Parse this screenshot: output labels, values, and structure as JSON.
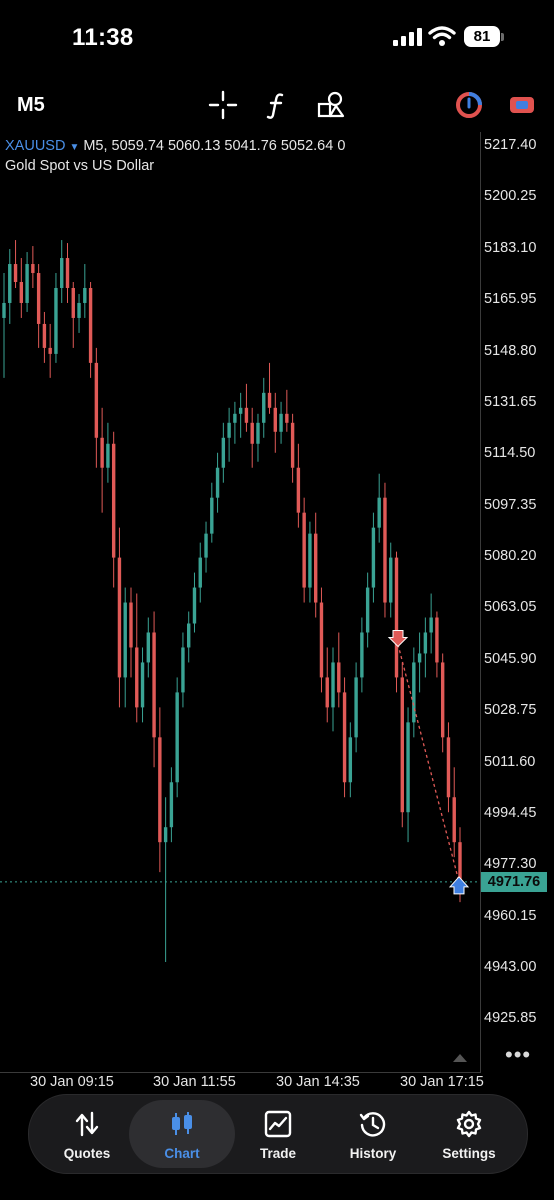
{
  "status_bar": {
    "time": "11:38",
    "battery": "81"
  },
  "toolbar": {
    "timeframe": "M5",
    "icons": [
      "crosshair-icon",
      "indicators-icon",
      "objects-icon",
      "one-click-trading-icon",
      "chart-color-icon"
    ]
  },
  "chart": {
    "symbol": "XAUUSD",
    "ohlc_line": "M5, 5059.74 5060.13 5041.76 5052.64 0",
    "description": "Gold Spot vs US Dollar",
    "current_price": "4971.76",
    "bullish_color": "#3aa394",
    "bearish_color": "#e05a57"
  },
  "chart_data": {
    "type": "candlestick",
    "price_axis": [
      "5217.40",
      "5200.25",
      "5183.10",
      "5165.95",
      "5148.80",
      "5131.65",
      "5114.50",
      "5097.35",
      "5080.20",
      "5063.05",
      "5045.90",
      "5028.75",
      "5011.60",
      "4994.45",
      "4977.30",
      "4960.15",
      "4943.00",
      "4925.85"
    ],
    "time_axis": [
      "30 Jan 09:15",
      "30 Jan 11:55",
      "30 Jan 14:35",
      "30 Jan 17:15"
    ],
    "ylim": [
      4918,
      5222
    ],
    "current_price": 4971.76,
    "trades": [
      {
        "type": "sell",
        "price": 5051
      },
      {
        "type": "buy",
        "price": 4971.76
      }
    ],
    "candles": [
      [
        5160,
        5175,
        5140,
        5165
      ],
      [
        5165,
        5183,
        5158,
        5178
      ],
      [
        5178,
        5186,
        5170,
        5172
      ],
      [
        5172,
        5180,
        5160,
        5165
      ],
      [
        5165,
        5182,
        5162,
        5178
      ],
      [
        5178,
        5184,
        5170,
        5175
      ],
      [
        5175,
        5178,
        5150,
        5158
      ],
      [
        5158,
        5162,
        5145,
        5150
      ],
      [
        5150,
        5158,
        5140,
        5148
      ],
      [
        5148,
        5175,
        5145,
        5170
      ],
      [
        5170,
        5186,
        5165,
        5180
      ],
      [
        5180,
        5185,
        5165,
        5170
      ],
      [
        5170,
        5172,
        5150,
        5160
      ],
      [
        5160,
        5168,
        5155,
        5165
      ],
      [
        5165,
        5178,
        5160,
        5170
      ],
      [
        5170,
        5172,
        5140,
        5145
      ],
      [
        5145,
        5150,
        5110,
        5120
      ],
      [
        5120,
        5130,
        5095,
        5110
      ],
      [
        5110,
        5125,
        5105,
        5118
      ],
      [
        5118,
        5122,
        5070,
        5080
      ],
      [
        5080,
        5090,
        5030,
        5040
      ],
      [
        5040,
        5070,
        5030,
        5065
      ],
      [
        5065,
        5070,
        5040,
        5050
      ],
      [
        5050,
        5068,
        5025,
        5030
      ],
      [
        5030,
        5050,
        5025,
        5045
      ],
      [
        5045,
        5060,
        5040,
        5055
      ],
      [
        5055,
        5062,
        5010,
        5020
      ],
      [
        5020,
        5030,
        4975,
        4985
      ],
      [
        4985,
        5000,
        4945,
        4990
      ],
      [
        4990,
        5010,
        4985,
        5005
      ],
      [
        5005,
        5040,
        5000,
        5035
      ],
      [
        5035,
        5055,
        5030,
        5050
      ],
      [
        5050,
        5062,
        5045,
        5058
      ],
      [
        5058,
        5075,
        5055,
        5070
      ],
      [
        5070,
        5085,
        5065,
        5080
      ],
      [
        5080,
        5092,
        5075,
        5088
      ],
      [
        5088,
        5105,
        5085,
        5100
      ],
      [
        5100,
        5115,
        5095,
        5110
      ],
      [
        5110,
        5125,
        5105,
        5120
      ],
      [
        5120,
        5130,
        5112,
        5125
      ],
      [
        5125,
        5132,
        5118,
        5128
      ],
      [
        5128,
        5135,
        5120,
        5130
      ],
      [
        5130,
        5138,
        5122,
        5125
      ],
      [
        5125,
        5130,
        5110,
        5118
      ],
      [
        5118,
        5128,
        5112,
        5125
      ],
      [
        5125,
        5140,
        5120,
        5135
      ],
      [
        5135,
        5145,
        5128,
        5130
      ],
      [
        5130,
        5135,
        5115,
        5122
      ],
      [
        5122,
        5132,
        5118,
        5128
      ],
      [
        5128,
        5136,
        5122,
        5125
      ],
      [
        5125,
        5128,
        5105,
        5110
      ],
      [
        5110,
        5118,
        5090,
        5095
      ],
      [
        5095,
        5100,
        5065,
        5070
      ],
      [
        5070,
        5092,
        5065,
        5088
      ],
      [
        5088,
        5095,
        5060,
        5065
      ],
      [
        5065,
        5070,
        5035,
        5040
      ],
      [
        5040,
        5050,
        5025,
        5030
      ],
      [
        5030,
        5050,
        5022,
        5045
      ],
      [
        5045,
        5055,
        5030,
        5035
      ],
      [
        5035,
        5040,
        5000,
        5005
      ],
      [
        5005,
        5025,
        5000,
        5020
      ],
      [
        5020,
        5045,
        5015,
        5040
      ],
      [
        5040,
        5060,
        5035,
        5055
      ],
      [
        5055,
        5075,
        5050,
        5070
      ],
      [
        5070,
        5095,
        5065,
        5090
      ],
      [
        5090,
        5108,
        5085,
        5100
      ],
      [
        5100,
        5105,
        5060,
        5065
      ],
      [
        5065,
        5085,
        5060,
        5080
      ],
      [
        5080,
        5082,
        5035,
        5040
      ],
      [
        5040,
        5045,
        4990,
        4995
      ],
      [
        4995,
        5030,
        4985,
        5025
      ],
      [
        5025,
        5050,
        5020,
        5045
      ],
      [
        5045,
        5055,
        5035,
        5048
      ],
      [
        5048,
        5060,
        5040,
        5055
      ],
      [
        5055,
        5068,
        5048,
        5060
      ],
      [
        5060,
        5062,
        5040,
        5045
      ],
      [
        5045,
        5048,
        5015,
        5020
      ],
      [
        5020,
        5025,
        4995,
        5000
      ],
      [
        5000,
        5010,
        4980,
        4985
      ],
      [
        4985,
        4990,
        4965,
        4972
      ]
    ]
  },
  "tabbar": {
    "tabs": [
      {
        "label": "Quotes",
        "icon": "quotes-icon"
      },
      {
        "label": "Chart",
        "icon": "chart-candles-icon"
      },
      {
        "label": "Trade",
        "icon": "trade-icon"
      },
      {
        "label": "History",
        "icon": "history-icon"
      },
      {
        "label": "Settings",
        "icon": "settings-gear-icon"
      }
    ],
    "active": "Chart"
  }
}
